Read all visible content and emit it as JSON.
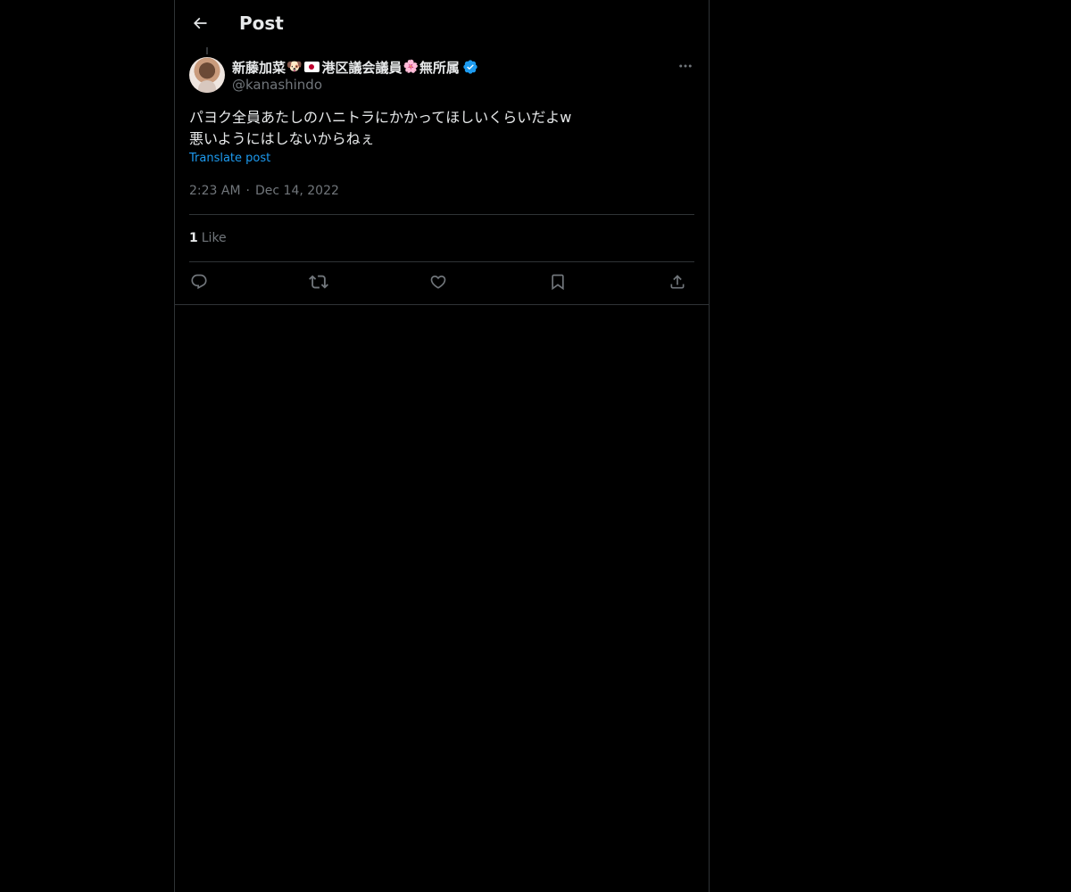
{
  "header": {
    "title": "Post"
  },
  "author": {
    "display_name": "新藤加菜",
    "emoji_dog": "🐶",
    "name_part2": "港区議会議員",
    "emoji_flower": "🌸",
    "name_part3": "無所属",
    "handle": "@kanashindo",
    "verified": true
  },
  "post": {
    "text": "パヨク全員あたしのハニトラにかかってほしいくらいだよw\n悪いようにはしないからねぇ",
    "translate_label": "Translate post",
    "time": "2:23 AM",
    "separator": "·",
    "date": "Dec 14, 2022"
  },
  "stats": {
    "likes_count": "1",
    "likes_label": "Like"
  },
  "icons": {
    "back": "back-arrow-icon",
    "more": "more-icon",
    "reply": "reply-icon",
    "repost": "repost-icon",
    "like": "heart-icon",
    "bookmark": "bookmark-icon",
    "share": "share-icon",
    "verified": "verified-badge-icon"
  },
  "colors": {
    "background": "#000000",
    "text": "#e7e9ea",
    "muted": "#71767b",
    "accent": "#1d9bf0",
    "border": "#2f3336"
  }
}
